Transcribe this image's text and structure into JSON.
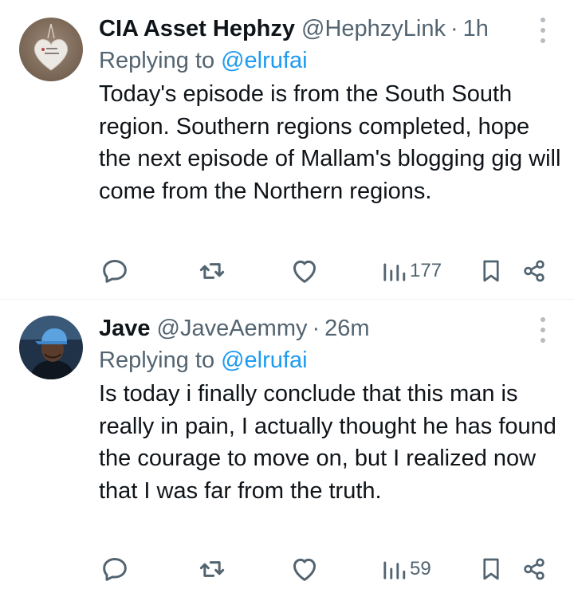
{
  "tweets": [
    {
      "display_name": "CIA Asset Hephzy",
      "handle": "@HephzyLink",
      "separator": "·",
      "time": "1h",
      "replying_prefix": "Replying to",
      "replying_to": "@elrufai",
      "body": "Today's episode is from the South South region. Southern regions completed, hope the next episode of Mallam's blogging gig will come from the Northern regions.",
      "views": "177",
      "avatar": "heart-pendant-avatar"
    },
    {
      "display_name": "Jave",
      "handle": "@JaveAemmy",
      "separator": "·",
      "time": "26m",
      "replying_prefix": "Replying to",
      "replying_to": "@elrufai",
      "body": "Is today i finally conclude that this man is really in pain, I actually thought he has found the courage to move on, but I realized now that I was far from the truth.",
      "views": "59",
      "avatar": "man-in-blue-cap-avatar"
    }
  ],
  "colors": {
    "text_primary": "#0f1419",
    "text_secondary": "#536471",
    "accent": "#1d9bf0",
    "divider": "#eff3f4"
  },
  "icons": [
    "reply-icon",
    "retweet-icon",
    "like-icon",
    "views-icon",
    "bookmark-icon",
    "share-icon",
    "more-icon"
  ]
}
